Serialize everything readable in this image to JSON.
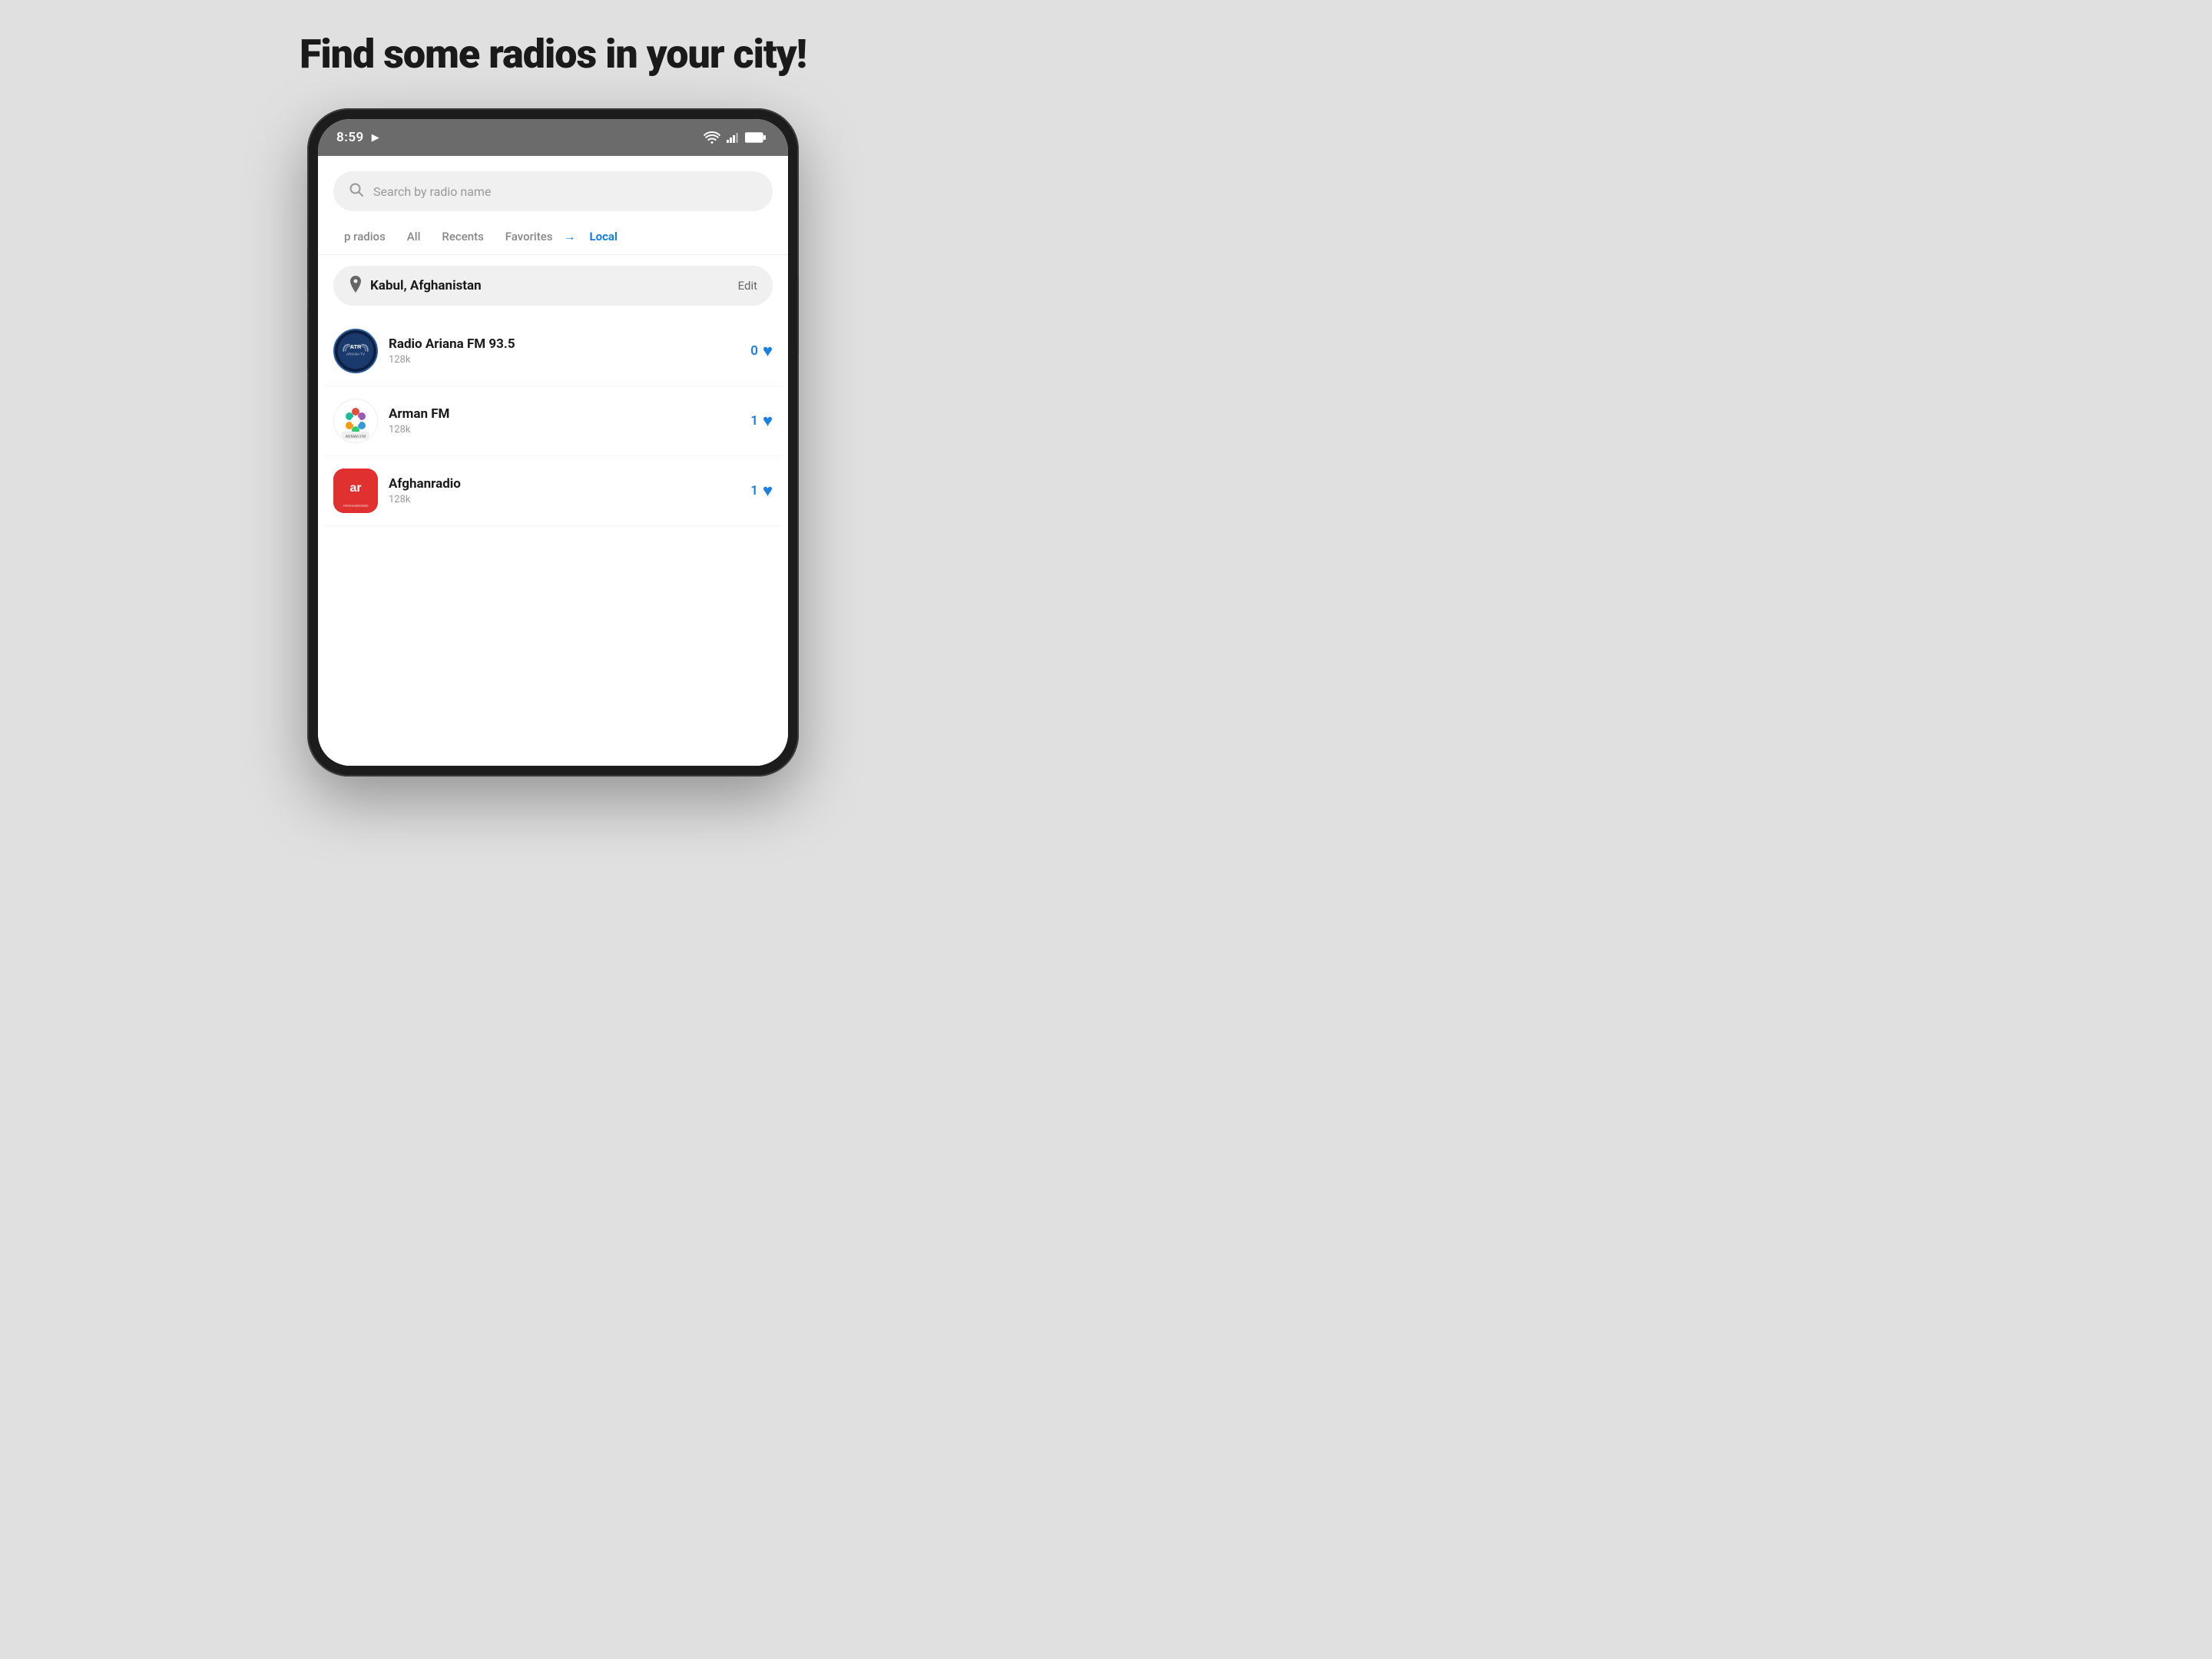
{
  "page": {
    "title": "Find some radios in your city!",
    "background_color": "#e0e0e0"
  },
  "status_bar": {
    "time": "8:59",
    "play_icon": "▶",
    "background": "#6b6b6b"
  },
  "search": {
    "placeholder": "Search by radio name"
  },
  "tabs": [
    {
      "label": "p radios",
      "active": false
    },
    {
      "label": "All",
      "active": false
    },
    {
      "label": "Recents",
      "active": false
    },
    {
      "label": "Favorites",
      "active": false
    },
    {
      "label": "Local",
      "active": true
    }
  ],
  "location": {
    "name": "Kabul, Afghanistan",
    "edit_label": "Edit"
  },
  "radios": [
    {
      "name": "Radio Ariana FM 93.5",
      "bitrate": "128k",
      "likes": "0",
      "logo_type": "ariana"
    },
    {
      "name": "Arman FM",
      "bitrate": "128k",
      "likes": "1",
      "logo_type": "arman"
    },
    {
      "name": "Afghanradio",
      "bitrate": "128k",
      "likes": "1",
      "logo_type": "afghan"
    }
  ]
}
